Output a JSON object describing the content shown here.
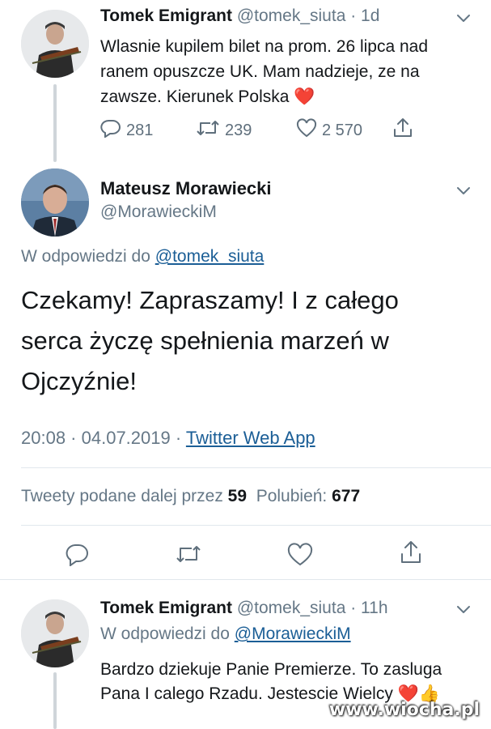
{
  "tweet1": {
    "author_name": "Tomek Emigrant",
    "handle": "@tomek_siuta",
    "time": "1d",
    "text": "Wlasnie kupilem bilet na prom. 26 lipca nad ranem opuszcze UK. Mam nadzieje, ze na zawsze. Kierunek Polska ❤️",
    "replies": "281",
    "retweets": "239",
    "likes": "2 570"
  },
  "tweet2": {
    "author_name": "Mateusz Morawiecki",
    "handle": "@MorawieckiM",
    "reply_prefix": "W odpowiedzi do",
    "reply_to": "@tomek_siuta",
    "text": "Czekamy! Zapraszamy! I z całego serca życzę spełnienia marzeń w Ojczyźnie!",
    "time": "20:08",
    "date": "04.07.2019",
    "source": "Twitter Web App",
    "retweets_label": "Tweety podane dalej przez",
    "retweets_count": "59",
    "likes_label": "Polubień:",
    "likes_count": "677"
  },
  "tweet3": {
    "author_name": "Tomek Emigrant",
    "handle": "@tomek_siuta",
    "time": "11h",
    "reply_prefix": "W odpowiedzi do",
    "reply_to": "@MorawieckiM",
    "text": "Bardzo dziekuje Panie Premierze. To zasluga Pana I calego Rzadu. Jestescie Wielcy ❤️👍"
  },
  "watermark": "www.wiocha.pl",
  "icons": [
    "reply-icon",
    "retweet-icon",
    "like-icon",
    "share-icon",
    "chevron-down-icon"
  ]
}
